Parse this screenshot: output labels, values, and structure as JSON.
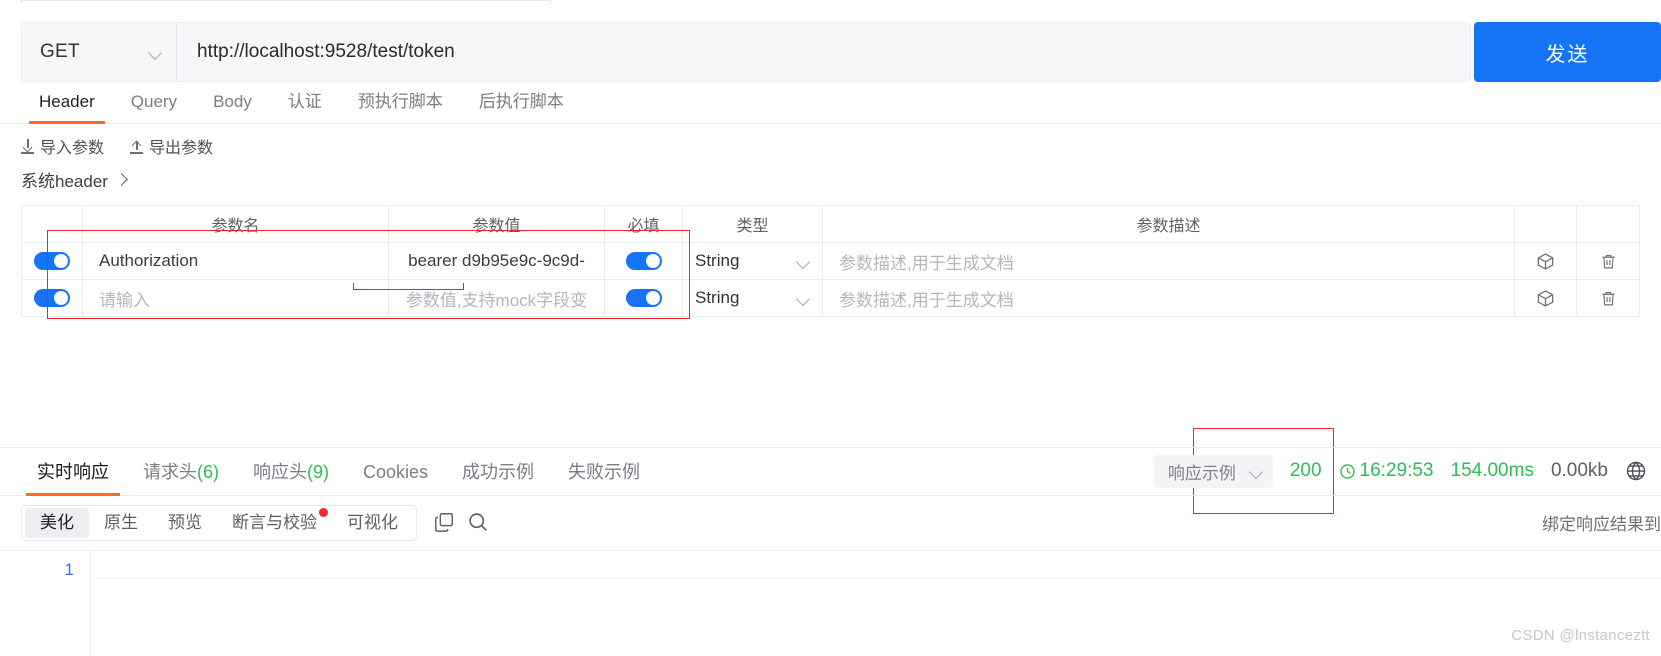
{
  "request": {
    "method": "GET",
    "method_icon": "chevron-down-icon",
    "url": "http://localhost:9528/test/token",
    "url_placeholder": "http://localhost:9528/test/token",
    "send_label": "发送"
  },
  "request_tabs": [
    {
      "label": "Header",
      "active": true
    },
    {
      "label": "Query",
      "active": false
    },
    {
      "label": "Body",
      "active": false
    },
    {
      "label": "认证",
      "active": false
    },
    {
      "label": "预执行脚本",
      "active": false
    },
    {
      "label": "后执行脚本",
      "active": false
    }
  ],
  "param_toolbar": {
    "import_label": "导入参数",
    "import_icon": "download-icon",
    "export_label": "导出参数",
    "export_icon": "upload-icon",
    "group_label": "系统header",
    "group_icon": "chevron-right-icon"
  },
  "params_table": {
    "headers": [
      "",
      "参数名",
      "参数值",
      "必填",
      "类型",
      "参数描述",
      "",
      ""
    ],
    "rows": [
      {
        "enabled": true,
        "name": "Authorization",
        "name_is_placeholder": false,
        "value": "bearer d9b95e9c-9c9d-",
        "value_is_placeholder": false,
        "required": true,
        "type": "String",
        "desc": "参数描述,用于生成文档",
        "desc_is_placeholder": true,
        "box_icon": "cube-icon",
        "delete_icon": "trash-icon"
      },
      {
        "enabled": true,
        "name": "请输入",
        "name_is_placeholder": true,
        "value": "参数值,支持mock字段变",
        "value_is_placeholder": true,
        "required": true,
        "type": "String",
        "desc": "参数描述,用于生成文档",
        "desc_is_placeholder": true,
        "box_icon": "cube-icon",
        "delete_icon": "trash-icon"
      }
    ]
  },
  "response_tabs": [
    {
      "label": "实时响应",
      "count": "",
      "active": true
    },
    {
      "label": "请求头",
      "count": "(6)",
      "active": false
    },
    {
      "label": "响应头",
      "count": "(9)",
      "active": false
    },
    {
      "label": "Cookies",
      "count": "",
      "active": false
    },
    {
      "label": "成功示例",
      "count": "",
      "active": false
    },
    {
      "label": "失败示例",
      "count": "",
      "active": false
    }
  ],
  "response_status": {
    "example_select": "响应示例",
    "example_icon": "chevron-down-icon",
    "code": "200",
    "clock_icon": "clock-icon",
    "time": "16:29:53",
    "duration": "154.00ms",
    "size": "0.00kb",
    "globe_icon": "globe-icon"
  },
  "view_toolbar": {
    "segments": [
      {
        "label": "美化",
        "active": true,
        "dot": false
      },
      {
        "label": "原生",
        "active": false,
        "dot": false
      },
      {
        "label": "预览",
        "active": false,
        "dot": false
      },
      {
        "label": "断言与校验",
        "active": false,
        "dot": true
      },
      {
        "label": "可视化",
        "active": false,
        "dot": false
      }
    ],
    "copy_icon": "copy-icon",
    "search_icon": "search-icon",
    "bind_label": "绑定响应结果到"
  },
  "editor": {
    "line_numbers": [
      "1"
    ]
  },
  "watermark": "CSDN @lnstanceztt",
  "colors": {
    "accent_orange": "#ff6a26",
    "primary_blue": "#1573f5",
    "success_green": "#2fbb5a",
    "annotation_red": "#e8262a"
  }
}
